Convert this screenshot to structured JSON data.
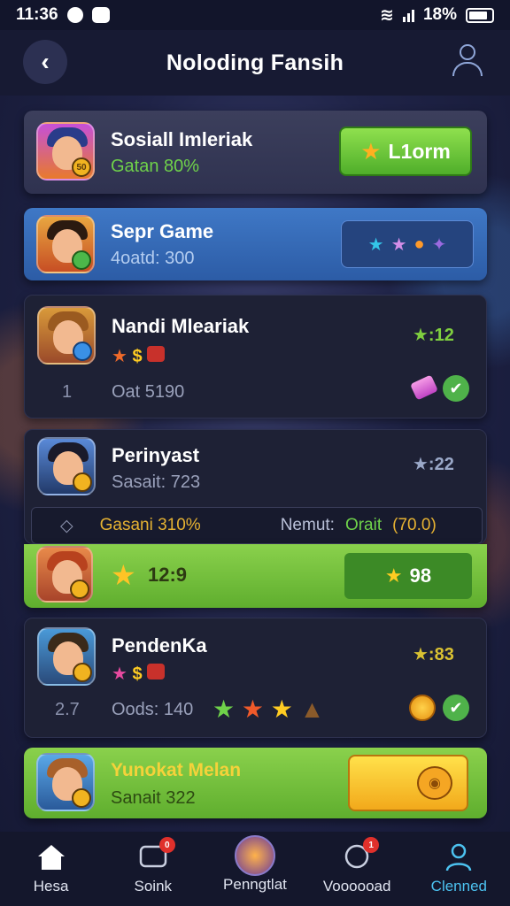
{
  "status_bar": {
    "time": "11:36",
    "battery": "18%"
  },
  "header": {
    "title": "Noloding Fansih"
  },
  "cards": [
    {
      "name": "Sosiall Imleriak",
      "sub": "Gatan 80%",
      "button": "L1orm"
    },
    {
      "name": "Sepr Game",
      "sub": "4oatd: 300"
    },
    {
      "name": "Nandi Mleariak",
      "rating": "★:12",
      "sub": "Oat 5190",
      "left_num": "1"
    },
    {
      "name": "Perinyast",
      "rating": "★:22",
      "sub": "Sasait: 723"
    },
    {
      "name": "PendenKa",
      "rating": "★:83",
      "sub": "Oods: 140",
      "left_num": "2.7"
    },
    {
      "name": "Yunokat Melan",
      "sub": "Sanait 322"
    }
  ],
  "sub_row": {
    "left": "Gasani 310%",
    "mid": "Nemut:",
    "mid2": "Orait",
    "right": "(70.0)"
  },
  "green_card": {
    "value": "12:9",
    "tray_value": "98"
  },
  "bottom_nav": [
    {
      "label": "Hesa"
    },
    {
      "label": "Soink",
      "badge": "0"
    },
    {
      "label": "Penngtlat"
    },
    {
      "label": "Voooooad",
      "badge": "1"
    },
    {
      "label": "Clenned"
    }
  ],
  "colors": {
    "accent": "#4cc2f0",
    "green": "#6fc23a",
    "blue_card": "#3f78c6"
  }
}
